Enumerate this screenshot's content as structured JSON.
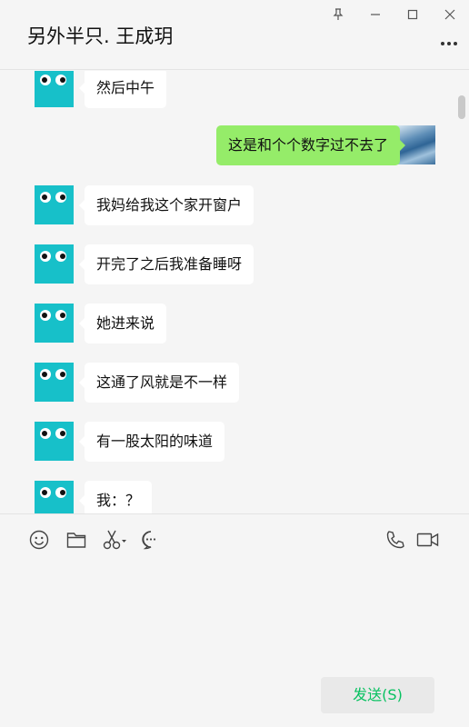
{
  "header": {
    "title": "另外半只. 王成玥",
    "icons": [
      "pin-icon",
      "minimize-icon",
      "maximize-icon",
      "close-icon",
      "more-icon"
    ]
  },
  "messages": [
    {
      "side": "left",
      "text": "然后中午"
    },
    {
      "side": "right",
      "text": "这是和个个数字过不去了"
    },
    {
      "side": "left",
      "text": "我妈给我这个家开窗户"
    },
    {
      "side": "left",
      "text": "开完了之后我准备睡呀"
    },
    {
      "side": "left",
      "text": "她进来说"
    },
    {
      "side": "left",
      "text": "这通了风就是不一样"
    },
    {
      "side": "left",
      "text": "有一股太阳的味道"
    },
    {
      "side": "left",
      "text": "我：？"
    }
  ],
  "toolbar": {
    "icons": [
      "emoji-icon",
      "folder-icon",
      "scissors-icon",
      "chat-history-icon",
      "phone-icon",
      "video-icon"
    ]
  },
  "input": {
    "value": ""
  },
  "send_label": "发送(S)",
  "colors": {
    "accent": "#07c160",
    "my_bubble": "#95ec69",
    "their_bubble": "#ffffff",
    "avatar": "#17c0c9"
  }
}
